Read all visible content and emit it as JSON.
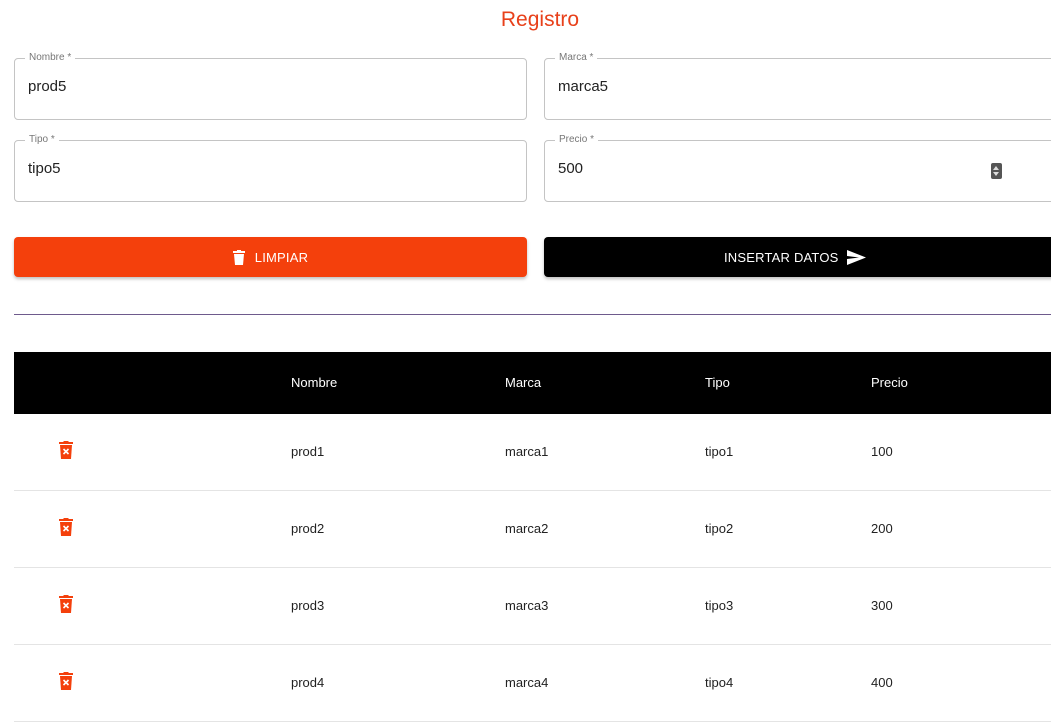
{
  "header": {
    "title": "Registro"
  },
  "form": {
    "nombre": {
      "label": "Nombre *",
      "value": "prod5"
    },
    "marca": {
      "label": "Marca *",
      "value": "marca5"
    },
    "tipo": {
      "label": "Tipo *",
      "value": "tipo5"
    },
    "precio": {
      "label": "Precio *",
      "value": "500"
    }
  },
  "buttons": {
    "clear_label": "LIMPIAR",
    "insert_label": "INSERTAR DATOS"
  },
  "table": {
    "headers": [
      "Nombre",
      "Marca",
      "Tipo",
      "Precio"
    ],
    "rows": [
      [
        "prod1",
        "marca1",
        "tipo1",
        "100"
      ],
      [
        "prod2",
        "marca2",
        "tipo2",
        "200"
      ],
      [
        "prod3",
        "marca3",
        "tipo3",
        "300"
      ],
      [
        "prod4",
        "marca4",
        "tipo4",
        "400"
      ]
    ]
  },
  "colors": {
    "accent": "#f4400c",
    "title": "#e8401a",
    "dark": "#000000",
    "divider": "#6e5a8c"
  },
  "icons": {
    "clear": "trash-icon",
    "insert": "send-icon",
    "row_delete": "delete-x-icon"
  }
}
